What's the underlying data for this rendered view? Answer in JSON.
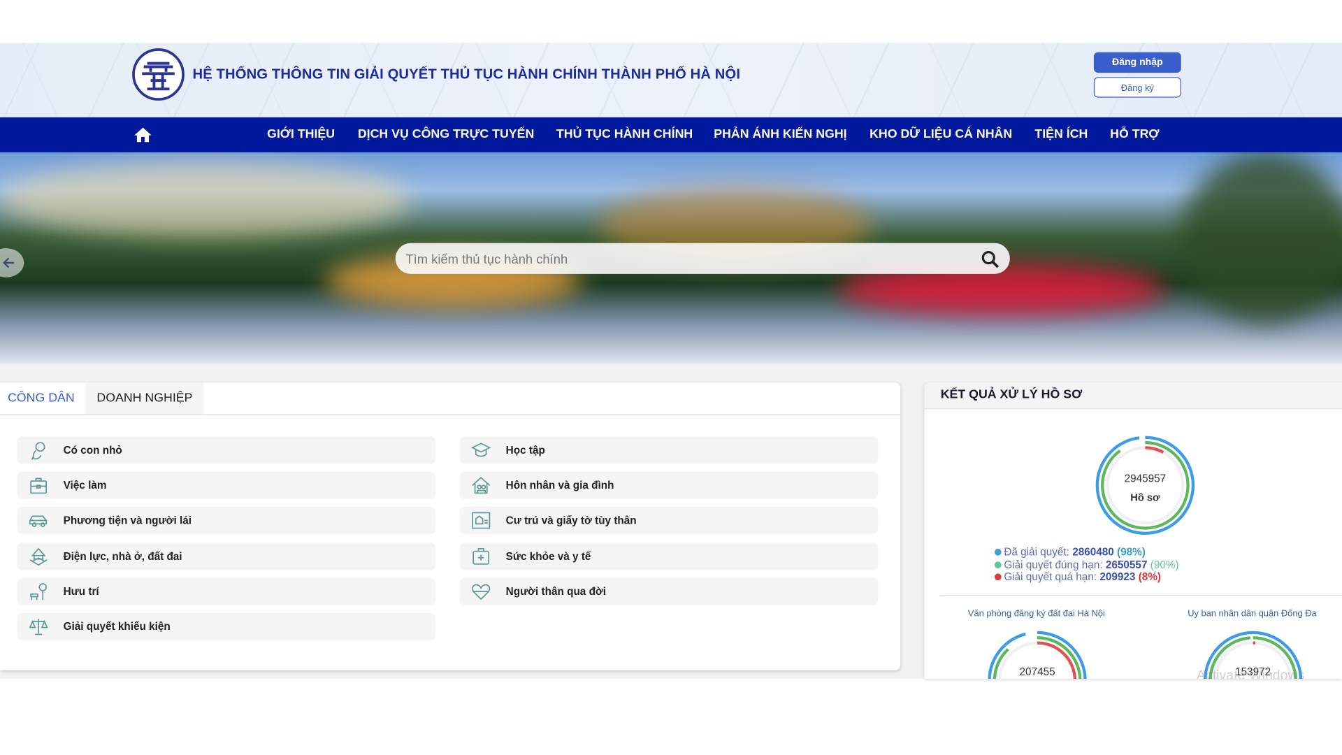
{
  "header": {
    "title": "HỆ THỐNG THÔNG TIN GIẢI QUYẾT THỦ TỤC HÀNH CHÍNH THÀNH PHỐ HÀ NỘI",
    "login_label": "Đăng nhập",
    "register_label": "Đăng ký",
    "logo_icon": "hanoi-emblem"
  },
  "nav": {
    "home_icon": "home-icon",
    "items": [
      "GIỚI THIỆU",
      "DỊCH VỤ CÔNG TRỰC TUYẾN",
      "THỦ TỤC HÀNH CHÍNH",
      "PHẢN ÁNH KIẾN NGHỊ",
      "KHO DỮ LIỆU CÁ NHÂN",
      "TIỆN ÍCH",
      "HỖ TRỢ"
    ]
  },
  "search": {
    "placeholder": "Tìm kiếm thủ tục hành chính",
    "icon": "search-icon"
  },
  "tabs": {
    "active": "CÔNG DÂN",
    "items": [
      "CÔNG DÂN",
      "DOANH NGHIỆP"
    ]
  },
  "categories": {
    "left": [
      {
        "label": "Có con nhỏ",
        "icon": "baby-icon"
      },
      {
        "label": "Việc làm",
        "icon": "briefcase-icon"
      },
      {
        "label": "Phương tiện và người lái",
        "icon": "car-icon"
      },
      {
        "label": "Điện lực, nhà ở, đất đai",
        "icon": "land-house-icon"
      },
      {
        "label": "Hưu trí",
        "icon": "retirement-bench-icon"
      },
      {
        "label": "Giải quyết khiếu kiện",
        "icon": "scales-icon"
      }
    ],
    "right": [
      {
        "label": "Học tập",
        "icon": "graduation-cap-icon"
      },
      {
        "label": "Hôn nhân và gia đình",
        "icon": "family-house-icon"
      },
      {
        "label": "Cư trú và giấy tờ tùy thân",
        "icon": "id-card-icon"
      },
      {
        "label": "Sức khỏe và y tế",
        "icon": "medical-kit-icon"
      },
      {
        "label": "Người thân qua đời",
        "icon": "heart-icon"
      }
    ]
  },
  "results": {
    "title": "KẾT QUẢ XỬ LÝ HỒ SƠ",
    "total": "2945957",
    "total_unit": "Hồ sơ",
    "legend": [
      {
        "label": "Đã giải quyết:",
        "value": "2860480",
        "percent": "(98%)",
        "color": "#3fa0d8",
        "pct_color": "#3b9ec9"
      },
      {
        "label": "Giải quyết đúng hạn:",
        "value": "2650557",
        "percent": "(90%)",
        "color": "#5fc89a",
        "pct_color": "#5fc89a"
      },
      {
        "label": "Giải quyết quá hạn:",
        "value": "209923",
        "percent": "(8%)",
        "color": "#e03a3a",
        "pct_color": "#d9363e"
      }
    ],
    "main_ring": {
      "blue": 0.98,
      "green": 0.9,
      "red": 0.08
    },
    "units": [
      {
        "name": "Văn phòng đăng ký đất đai Hà Nội",
        "total": "207455",
        "ring": {
          "blue": 0.96,
          "green": 0.88,
          "red": 0.45
        }
      },
      {
        "name": "Uy ban nhân dân quận Đống Đa",
        "total": "153972",
        "ring": {
          "blue": 1.0,
          "green": 0.99,
          "red": 0.01
        }
      }
    ],
    "colors": {
      "blue": "#3d9be9",
      "green": "#5cb85c",
      "red": "#e05050",
      "track": "#f0f0f0"
    }
  },
  "watermark": "Activate Windows"
}
